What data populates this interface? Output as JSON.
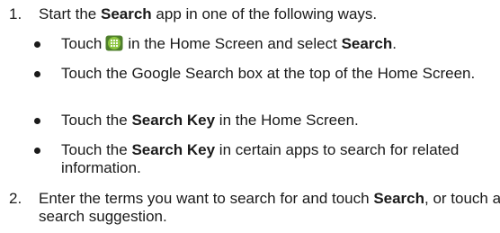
{
  "list": {
    "item1": {
      "number": "1.",
      "pre": "Start the ",
      "bold": "Search",
      "post": " app in one of the following ways."
    },
    "bullets": [
      {
        "pre": "Touch",
        "icon": "launcher-grid-icon",
        "mid": "in the Home Screen and select ",
        "bold": "Search",
        "post": "."
      },
      {
        "text": "Touch the Google Search box at the top of the Home Screen."
      },
      {
        "pre": "Touch the ",
        "bold": "Search Key",
        "post": " in the Home Screen."
      },
      {
        "pre": "Touch the ",
        "bold": "Search Key",
        "post": " in certain apps to search for related information."
      }
    ],
    "item2": {
      "number": "2.",
      "pre": "Enter the terms you want to search for and touch ",
      "bold": "Search",
      "post": ", or touch a search suggestion."
    }
  },
  "colors": {
    "text": "#1a1a1a",
    "icon_green": "#6aa832"
  }
}
